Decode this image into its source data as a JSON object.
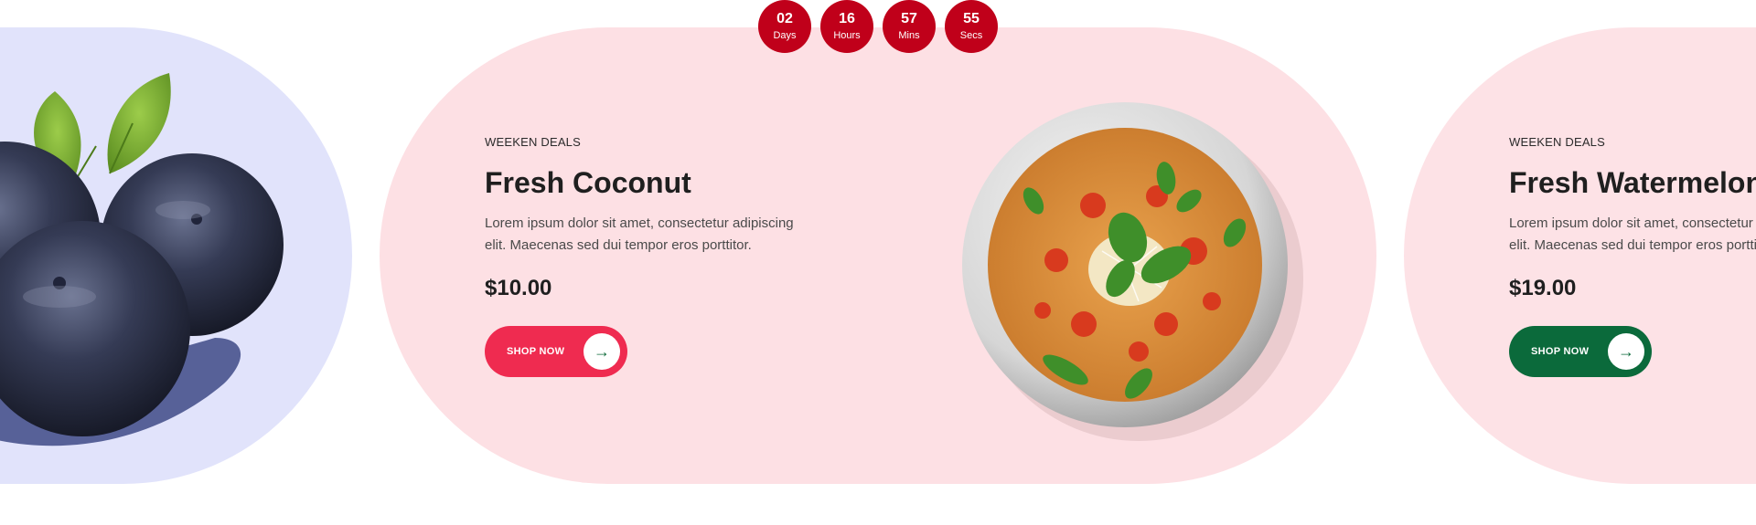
{
  "countdown": {
    "days": {
      "value": "02",
      "label": "Days"
    },
    "hours": {
      "value": "16",
      "label": "Hours"
    },
    "mins": {
      "value": "57",
      "label": "Mins"
    },
    "secs": {
      "value": "55",
      "label": "Secs"
    }
  },
  "slides": {
    "center": {
      "tag": "WEEKEN DEALS",
      "title": "Fresh Coconut",
      "description": "Lorem ipsum dolor sit amet, consectetur adipiscing elit. Maecenas sed dui tempor eros porttitor.",
      "price": "$10.00",
      "button_label": "SHOP NOW",
      "button_icon": "arrow-right-icon",
      "image": "spaghetti-plate"
    },
    "right": {
      "tag": "WEEKEN DEALS",
      "title": "Fresh Watermelon",
      "description": "Lorem ipsum dolor sit amet, consectetur adipiscing elit. Maecenas sed dui tempor eros porttitor.",
      "price": "$19.00",
      "button_label": "SHOP NOW",
      "button_icon": "arrow-right-icon"
    },
    "left": {
      "image": "blueberries"
    }
  },
  "colors": {
    "countdown_bg": "#c0001a",
    "center_card_bg": "#fde0e4",
    "left_card_bg": "#e1e3fb",
    "right_card_bg": "#fde2e6",
    "button_pink": "#ef2b50",
    "button_green": "#0b6a3b"
  }
}
